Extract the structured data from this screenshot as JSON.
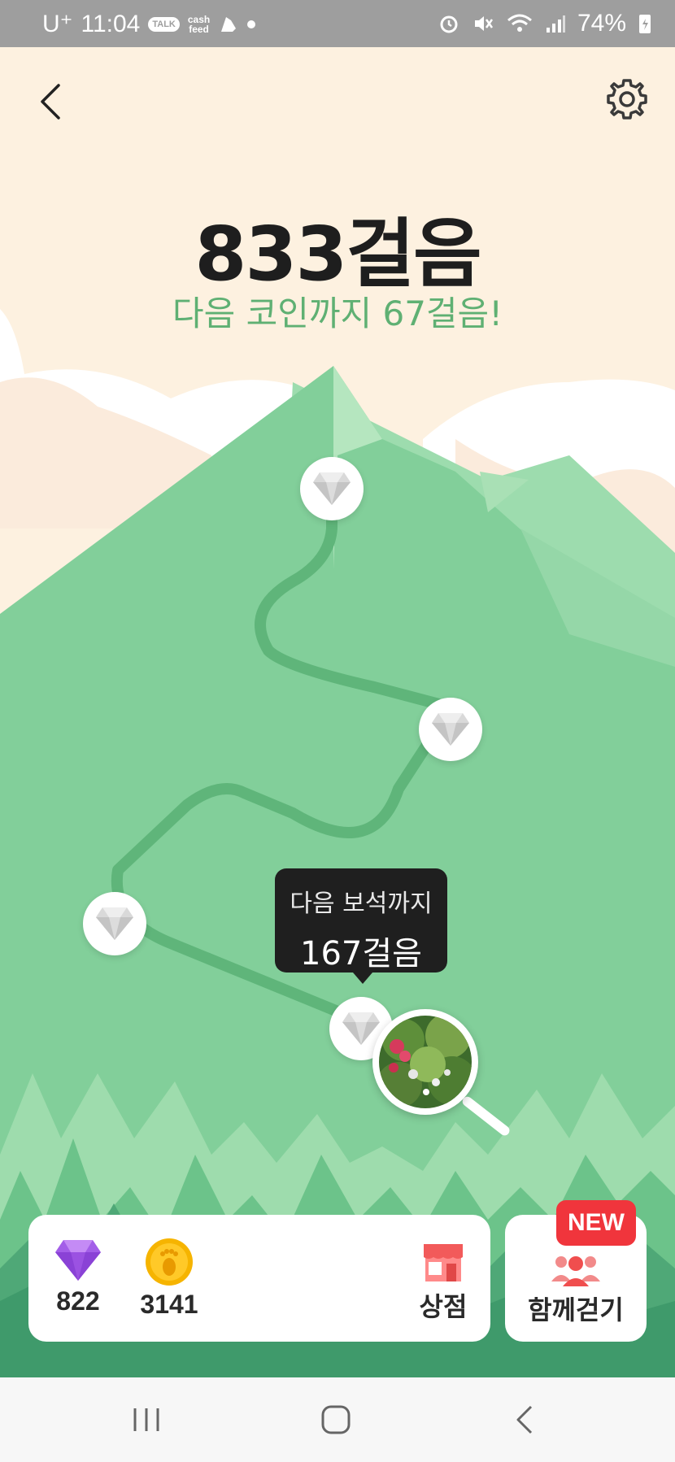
{
  "status_bar": {
    "carrier": "U⁺",
    "time": "11:04",
    "talk_badge": "TALK",
    "cashfeed_line1": "cash",
    "cashfeed_line2": "feed",
    "battery": "74%"
  },
  "header": {
    "steps_title": "833걸음",
    "subtitle": "다음 코인까지 67걸음!"
  },
  "tooltip": {
    "line1": "다음 보석까지",
    "line2": "167걸음"
  },
  "wallet": {
    "gems": "822",
    "coins": "3141",
    "shop_label": "상점"
  },
  "walk_together": {
    "label": "함께걷기",
    "badge": "NEW"
  },
  "colors": {
    "background": "#fdf1e0",
    "mountain": "#82cf9a",
    "path": "#5fb57a",
    "accent_text": "#5fb073",
    "new_badge": "#f0353c"
  }
}
